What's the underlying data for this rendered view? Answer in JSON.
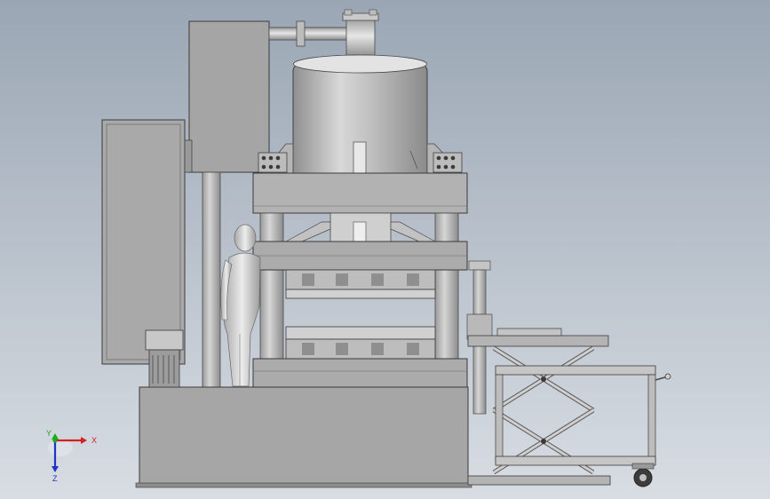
{
  "viewport": {
    "background_top": "#9aa6b4",
    "background_bottom": "#d8dde3"
  },
  "triad": {
    "x_label": "X",
    "y_label": "Y",
    "z_label": "Z",
    "x_color": "#d42020",
    "y_color": "#1eaa20",
    "z_color": "#2035c8"
  }
}
